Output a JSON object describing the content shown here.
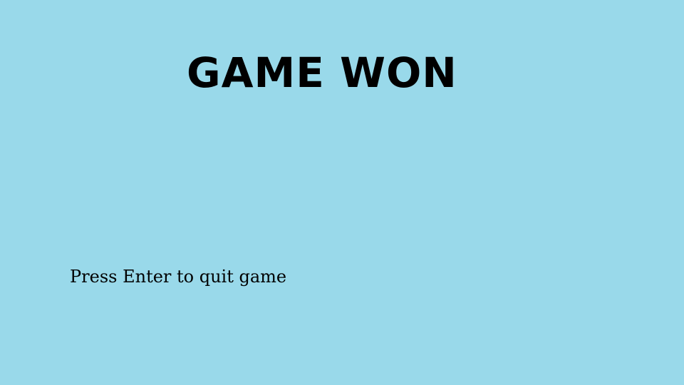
{
  "screen": {
    "title": "GAME WON",
    "prompt": "Press Enter to quit game"
  },
  "colors": {
    "background": "#99d9ea",
    "text": "#000000"
  }
}
